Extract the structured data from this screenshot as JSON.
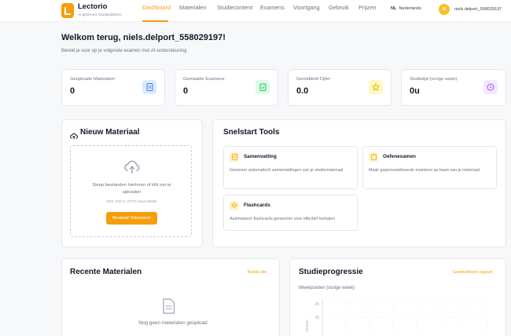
{
  "brand": {
    "name": "Lectorio",
    "tagline": "AI-gedreven Studieplatform"
  },
  "nav": {
    "links": [
      "Dashboard",
      "Materialen",
      "Studiecontent",
      "Examens",
      "Voortgang",
      "Gebruik",
      "Prijzen"
    ],
    "active": "Dashboard",
    "lang_code": "NL",
    "lang_name": "Nederlands",
    "avatar_initials": "NI",
    "username": "niels.delport_558029197"
  },
  "header": {
    "title": "Welkom terug, niels.delport_558029197!",
    "subtitle": "Bereid je voor op je volgende examen met AI-ondersteuning"
  },
  "stats": [
    {
      "label": "Geüploade Materialen",
      "value": "0",
      "icon": "document-icon",
      "color": "#3b82f6"
    },
    {
      "label": "Gemaakte Examens",
      "value": "0",
      "icon": "clipboard-check-icon",
      "color": "#22c55e"
    },
    {
      "label": "Gemiddeld Cijfer",
      "value": "0.0",
      "icon": "star-icon",
      "color": "#eab308"
    },
    {
      "label": "Studietijd (vorige week)",
      "value": "0u",
      "icon": "clock-icon",
      "color": "#a855f7"
    }
  ],
  "upload": {
    "title": "Nieuw Materiaal",
    "drop_line1": "Sleep bestanden hierheen of klik om te",
    "drop_line2": "uploaden",
    "formats": "PDF, DOCX, PPTX (max 50MB)",
    "button": "Bestand Selecteren"
  },
  "tools": {
    "title": "Snelstart Tools",
    "items": [
      {
        "name": "Samenvatting",
        "desc": "Genereer automatisch samenvattingen van je studiemateriaal",
        "icon": "document-text-icon",
        "color": "#f59e0b"
      },
      {
        "name": "Oefenexamen",
        "desc": "Maak gepersonaliseerde examens op basis van je materiaal",
        "icon": "clipboard-icon",
        "color": "#f59e0b"
      },
      {
        "name": "Flashcards",
        "desc": "Automatisch flashcards genereren voor effectief herhalen",
        "icon": "layers-icon",
        "color": "#f59e0b"
      }
    ]
  },
  "recent": {
    "title": "Recente Materialen",
    "link": "Bekijk alle",
    "empty": "Nog geen materialen geüpload"
  },
  "progress": {
    "title": "Studieprogressie",
    "link": "Gedetailleerd rapport",
    "subtitle": "Weekpunten (vorige week)"
  },
  "chart_data": {
    "type": "line",
    "title": "",
    "ylabel": "Punten",
    "yticks": [
      20,
      15
    ],
    "series": []
  }
}
